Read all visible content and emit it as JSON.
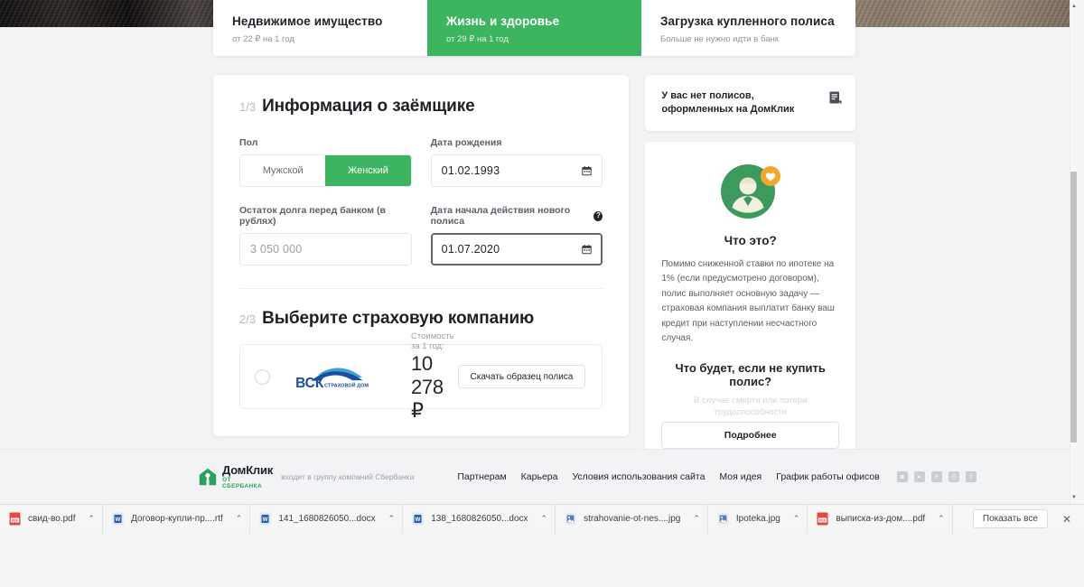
{
  "hero": {
    "alt": "photo-banner"
  },
  "tabs": [
    {
      "title": "Недвижимое имущество",
      "sub": "от 22 ₽ на 1 год",
      "active": false
    },
    {
      "title": "Жизнь и здоровье",
      "sub": "от 29 ₽ на 1 год",
      "active": true
    },
    {
      "title": "Загрузка купленного полиса",
      "sub": "Больше не нужно идти в банк",
      "active": false
    }
  ],
  "section1": {
    "number": "1/3",
    "title": "Информация о заёмщике",
    "gender": {
      "label": "Пол",
      "options": [
        "Мужской",
        "Женский"
      ],
      "selected": "Женский"
    },
    "birthdate": {
      "label": "Дата рождения",
      "value": "01.02.1993"
    },
    "debt": {
      "label": "Остаток долга перед банком (в рублях)",
      "value": "3 050 000"
    },
    "policy_start": {
      "label": "Дата начала действия нового полиса",
      "help": "?",
      "value": "01.07.2020"
    }
  },
  "section2": {
    "number": "2/3",
    "title": "Выберите страховую компанию",
    "offer": {
      "company": "ВСК",
      "company_sub": "СТРАХОВОЙ ДОМ",
      "price_caption": "Стоимость за 1 год:",
      "price": "10 278 ₽",
      "download_label": "Скачать образец полиса",
      "selected": false
    }
  },
  "sidebar": {
    "policies_card": {
      "text": "У вас нет полисов, оформленных на ДомКлик",
      "icon": "note-icon"
    },
    "info_card": {
      "illustration": "doctor-avatar-icon",
      "badge": "heart-icon",
      "heading": "Что это?",
      "paragraph": "Помимо сниженной ставки по ипотеке на 1% (если предусмотрено договором), полис выполняет основную задачу — страховая компания выплатит банку ваш кредит при наступлении несчастного случая.",
      "heading2": "Что будет, если не купить полис?",
      "faded_text": "В случае смерти или потери трудоспособности",
      "button": "Подробнее"
    }
  },
  "footer": {
    "logo_main": "ДомКлик",
    "logo_sub": "ОТ СБЕРБАНКА",
    "tagline": "входит в группу компаний Сбербанка",
    "links": [
      "Партнерам",
      "Карьера",
      "Условия использования сайта",
      "Моя идея",
      "График работы офисов"
    ],
    "social": [
      {
        "name": "instagram-icon",
        "glyph": "◙"
      },
      {
        "name": "youtube-icon",
        "glyph": "▸"
      },
      {
        "name": "telegram-icon",
        "glyph": "✈"
      },
      {
        "name": "vk-icon",
        "glyph": "✉"
      },
      {
        "name": "facebook-icon",
        "glyph": "f"
      }
    ]
  },
  "downloads": {
    "items": [
      {
        "name": "свид-во.pdf",
        "type": "pdf"
      },
      {
        "name": "Договор-купли-пр....rtf",
        "type": "doc"
      },
      {
        "name": "141_1680826050...docx",
        "type": "doc"
      },
      {
        "name": "138_1680826050...docx",
        "type": "doc"
      },
      {
        "name": "strahovanie-ot-nes....jpg",
        "type": "img"
      },
      {
        "name": "Ipoteka.jpg",
        "type": "img"
      },
      {
        "name": "выписка-из-дом....pdf",
        "type": "pdf"
      }
    ],
    "show_all": "Показать все",
    "close": "✕",
    "caret": "⌃"
  },
  "colors": {
    "accent_green": "#3db460",
    "brand_green": "#2aa35a",
    "text_dark": "#21252b",
    "text_muted": "#8e959e",
    "border": "#e3e6ea",
    "page_bg": "#f2f3f5",
    "badge_orange": "#f0a92e",
    "vsk_blue": "#1b4e9b"
  }
}
